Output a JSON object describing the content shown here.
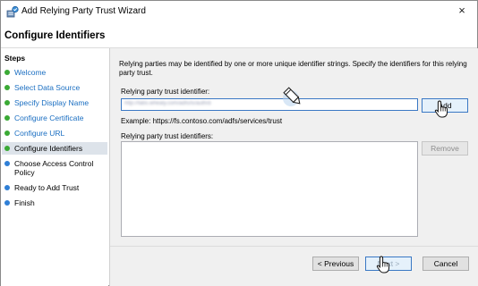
{
  "window": {
    "title": "Add Relying Party Trust Wizard",
    "close_glyph": "×",
    "app_icon": "relying-party-wizard-icon"
  },
  "header": {
    "title": "Configure Identifiers"
  },
  "steps": {
    "title": "Steps",
    "items": [
      {
        "label": "Welcome",
        "status": "completed",
        "color": "#3aaa35"
      },
      {
        "label": "Select Data Source",
        "status": "completed",
        "color": "#3aaa35"
      },
      {
        "label": "Specify Display Name",
        "status": "completed",
        "color": "#3aaa35"
      },
      {
        "label": "Configure Certificate",
        "status": "completed",
        "color": "#3aaa35"
      },
      {
        "label": "Configure URL",
        "status": "completed",
        "color": "#3aaa35"
      },
      {
        "label": "Configure Identifiers",
        "status": "current",
        "color": "#3aaa35"
      },
      {
        "label": "Choose Access Control Policy",
        "status": "pending",
        "color": "#2f7fd6"
      },
      {
        "label": "Ready to Add Trust",
        "status": "pending",
        "color": "#2f7fd6"
      },
      {
        "label": "Finish",
        "status": "pending",
        "color": "#2f7fd6"
      }
    ]
  },
  "main": {
    "description": "Relying parties may be identified by one or more unique identifier strings. Specify the identifiers for this relying party trust.",
    "identifier_label": "Relying party trust identifier:",
    "identifier_value": "http://fabs.whealy.com/adfs/ls/auth/d",
    "add_label": "Add",
    "example": "Example: https://fs.contoso.com/adfs/services/trust",
    "list_label": "Relying party trust identifiers:",
    "list_items": [],
    "remove_label": "Remove"
  },
  "footer": {
    "previous_label": "< Previous",
    "next_label": "Next >",
    "cancel_label": "Cancel"
  },
  "cursors": {
    "pencil": "pencil-cursor-icon",
    "hand": "hand-pointer-cursor-icon"
  }
}
